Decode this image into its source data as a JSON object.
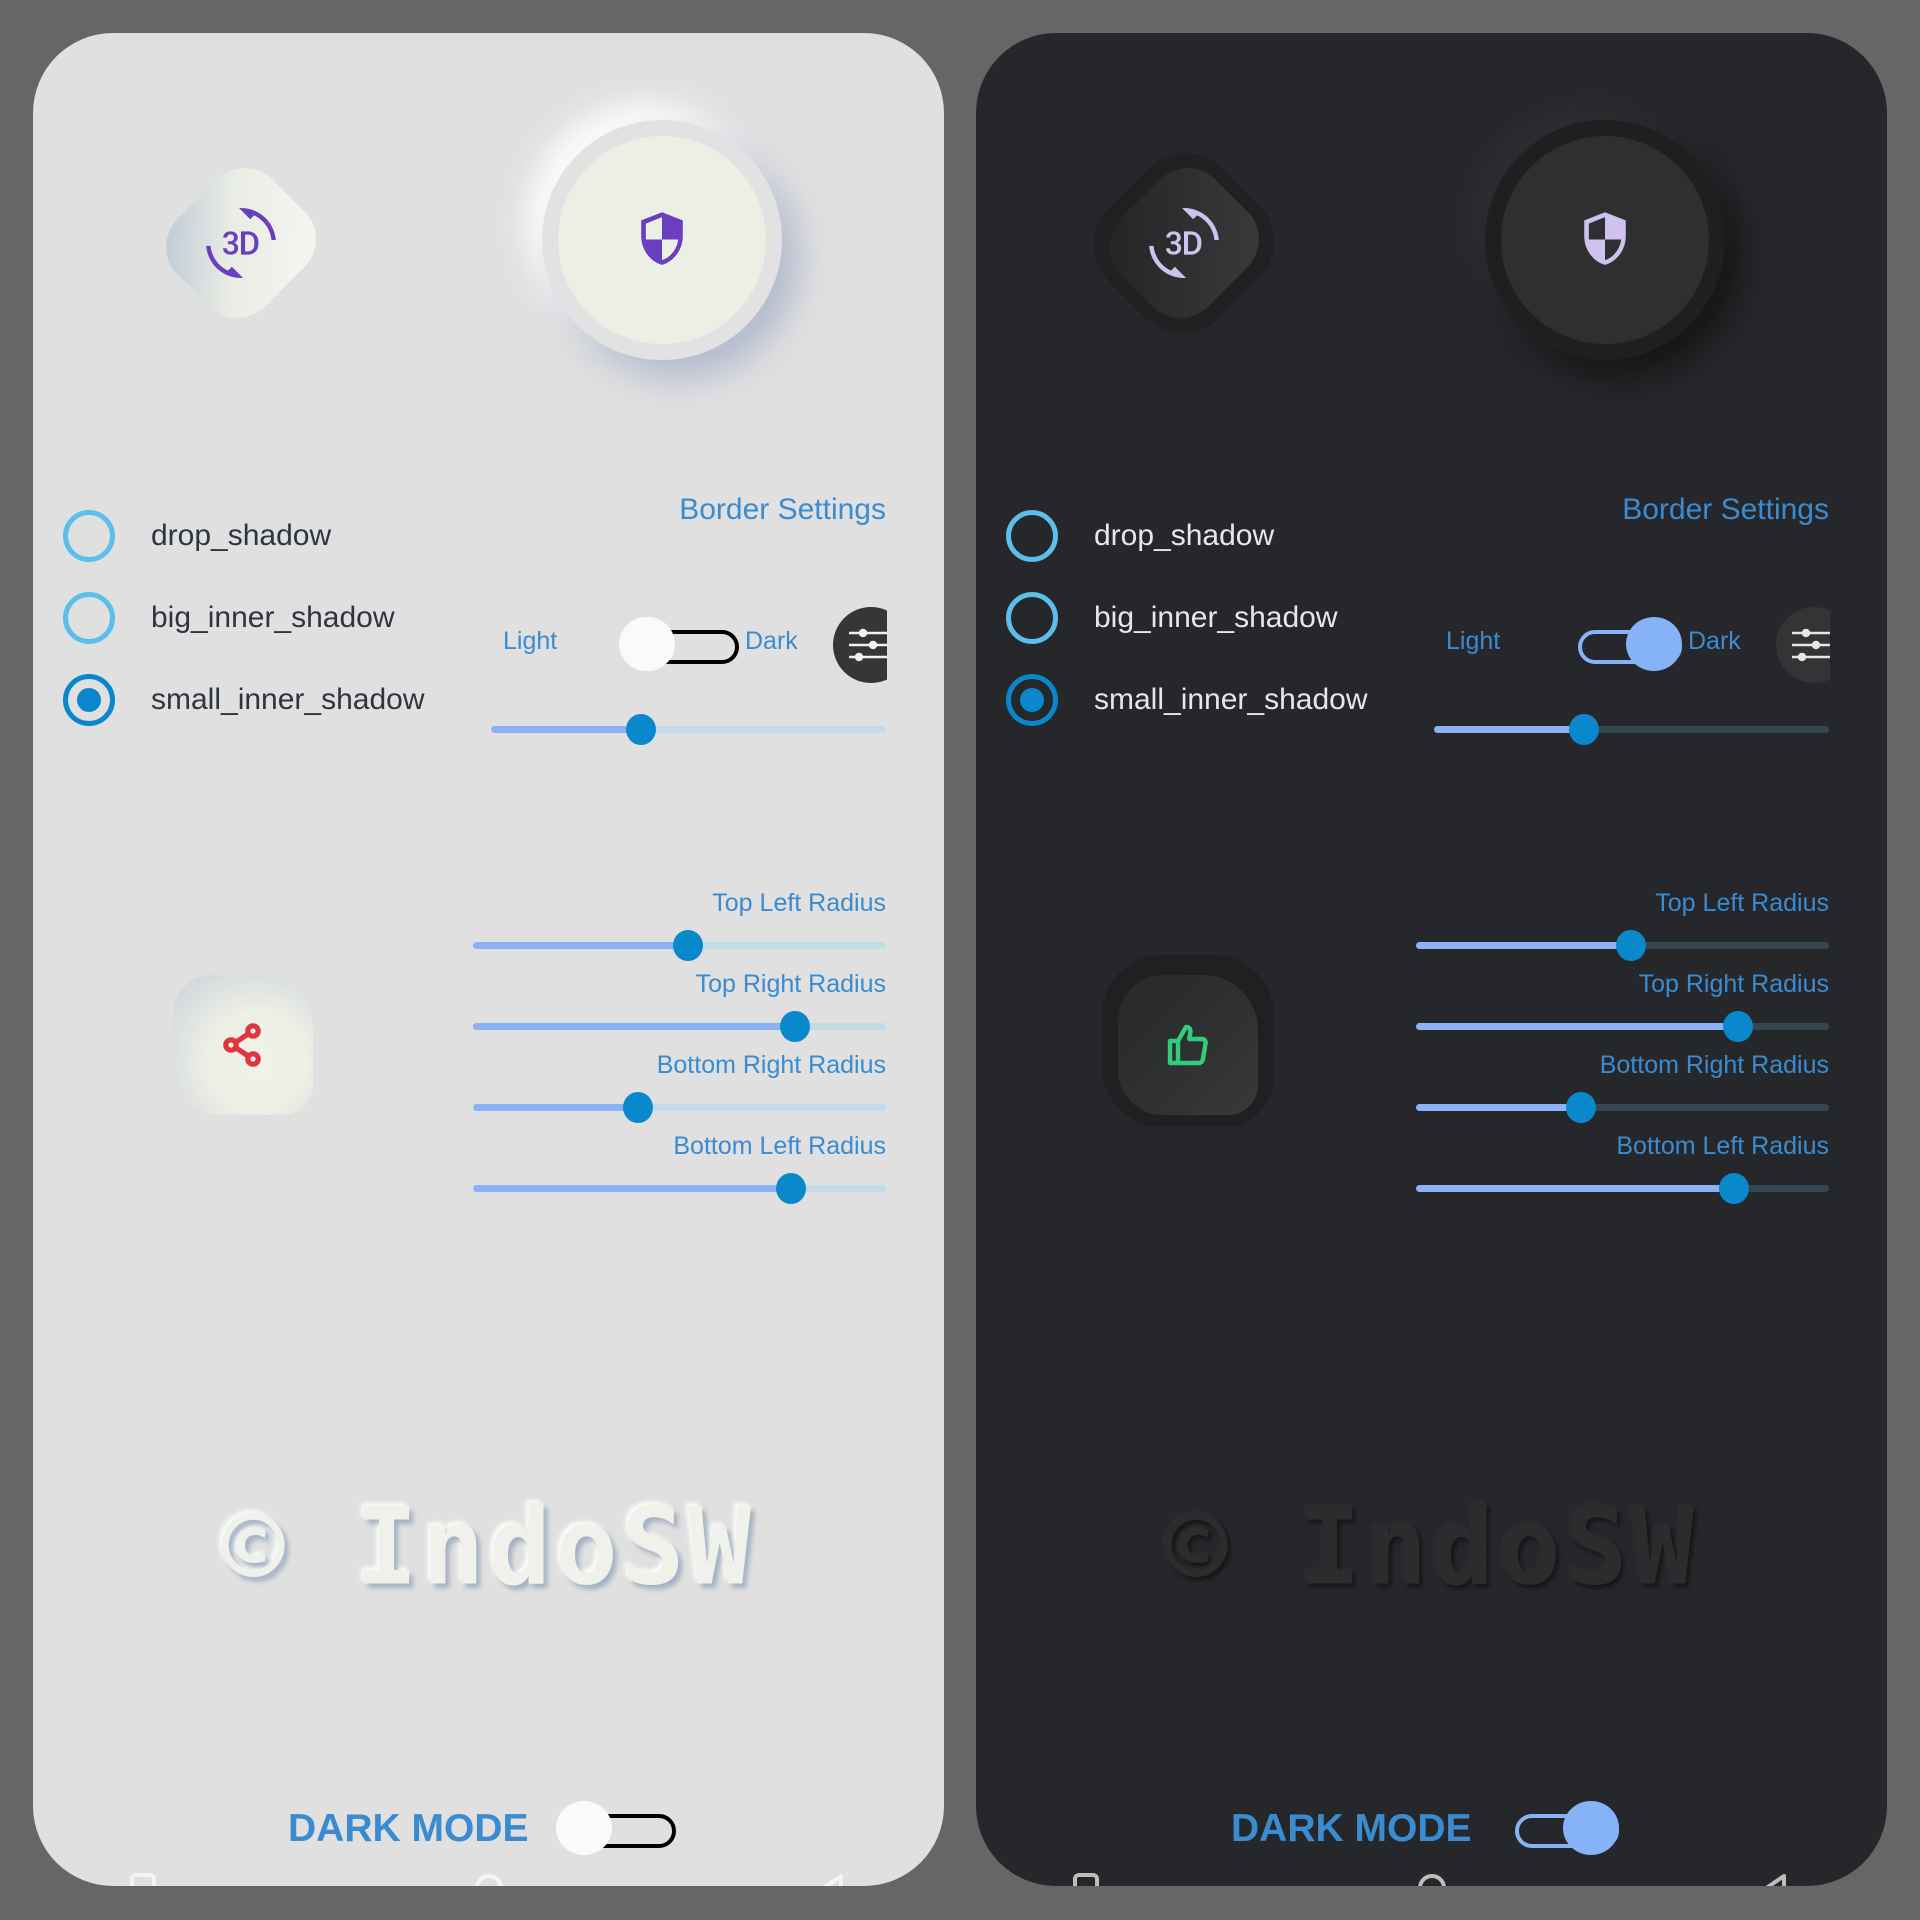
{
  "panels": [
    {
      "theme": "light",
      "buttons": {
        "diamond_icon": "3d-rotation-icon",
        "circle_icon": "shield-icon",
        "radius_box_icon": "share-icon"
      },
      "radios": [
        {
          "label": "drop_shadow",
          "checked": false
        },
        {
          "label": "big_inner_shadow",
          "checked": false
        },
        {
          "label": "small_inner_shadow",
          "checked": true
        }
      ],
      "border_settings_label": "Border Settings",
      "theme_toggle": {
        "left_label": "Light",
        "right_label": "Dark",
        "on": false
      },
      "settings_icon": "tune-sliders-icon",
      "intensity_slider": {
        "value": 0.38
      },
      "radius_sliders": [
        {
          "label": "Top Left Radius",
          "value": 0.52
        },
        {
          "label": "Top Right Radius",
          "value": 0.78
        },
        {
          "label": "Bottom Right Radius",
          "value": 0.4
        },
        {
          "label": "Bottom Left Radius",
          "value": 0.77
        }
      ],
      "watermark": "© IndoSW",
      "dark_mode": {
        "label": "DARK MODE",
        "on": false
      }
    },
    {
      "theme": "dark",
      "buttons": {
        "diamond_icon": "3d-rotation-icon",
        "circle_icon": "shield-icon",
        "radius_box_icon": "thumbs-up-icon"
      },
      "radios": [
        {
          "label": "drop_shadow",
          "checked": false
        },
        {
          "label": "big_inner_shadow",
          "checked": false
        },
        {
          "label": "small_inner_shadow",
          "checked": true
        }
      ],
      "border_settings_label": "Border Settings",
      "theme_toggle": {
        "left_label": "Light",
        "right_label": "Dark",
        "on": true
      },
      "settings_icon": "tune-sliders-icon",
      "intensity_slider": {
        "value": 0.38
      },
      "radius_sliders": [
        {
          "label": "Top Left Radius",
          "value": 0.52
        },
        {
          "label": "Top Right Radius",
          "value": 0.78
        },
        {
          "label": "Bottom Right Radius",
          "value": 0.4
        },
        {
          "label": "Bottom Left Radius",
          "value": 0.77
        }
      ],
      "watermark": "© IndoSW",
      "dark_mode": {
        "label": "DARK MODE",
        "on": true
      }
    }
  ],
  "colors": {
    "accent_blue": "#3a8bd0",
    "slider_knob": "#0a88cc",
    "slider_fill": "#8ab2f5",
    "radio_unchecked": "#5bbfea",
    "radio_checked": "#0a87cc",
    "icon_purple_light": "#6a3fbf",
    "icon_purple_dark": "#cfc2ee",
    "share_red": "#e0343f",
    "thumb_green": "#2fcf7a"
  }
}
